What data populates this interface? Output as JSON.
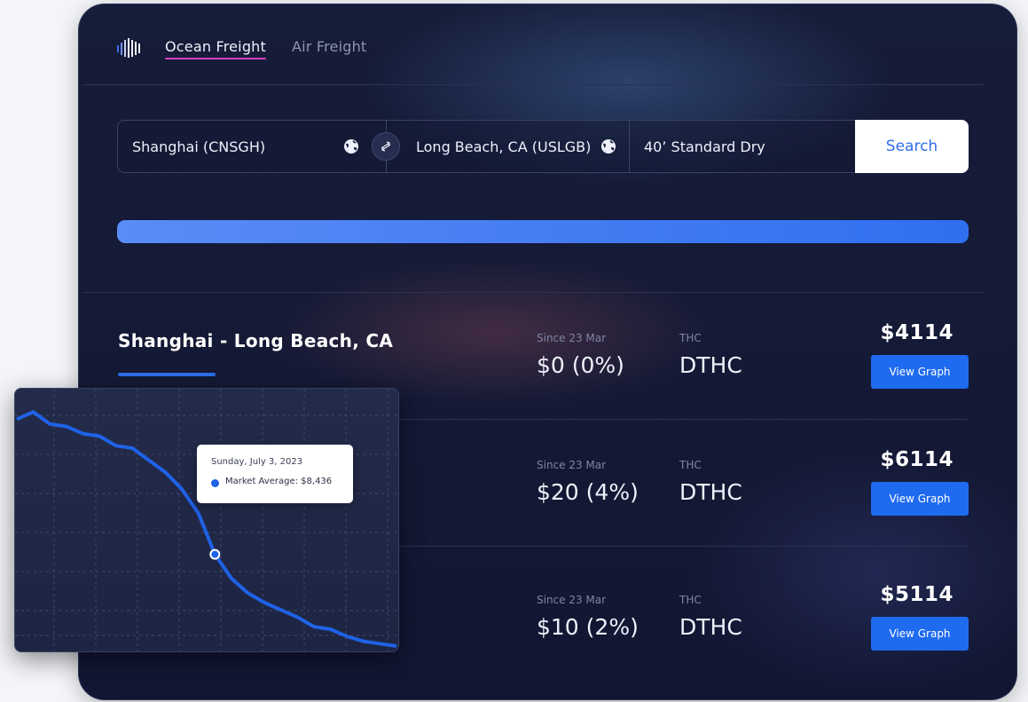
{
  "header": {
    "logo_icon": "barcode-logo-icon",
    "tabs": [
      {
        "label": "Ocean Freight",
        "active": true
      },
      {
        "label": "Air Freight",
        "active": false
      }
    ]
  },
  "search": {
    "origin": "Shanghai (CNSGH)",
    "destination": "Long Beach, CA (USLGB)",
    "container": "40’ Standard Dry",
    "button_label": "Search",
    "swap_icon": "swap-arrows-icon",
    "globe_icon": "globe-icon"
  },
  "progress": {
    "value": 1.0
  },
  "route": {
    "title": "Shanghai - Long Beach, CA"
  },
  "rows": [
    {
      "since_label": "Since 23 Mar",
      "change": "$0 (0%)",
      "thc_label": "THC",
      "thc_value": "DTHC",
      "price": "$4114",
      "button": "View Graph"
    },
    {
      "since_label": "Since 23 Mar",
      "change": "$20 (4%)",
      "thc_label": "THC",
      "thc_value": "DTHC",
      "price": "$6114",
      "button": "View Graph"
    },
    {
      "since_label": "Since 23 Mar",
      "change": "$10 (2%)",
      "thc_label": "THC",
      "thc_value": "DTHC",
      "price": "$5114",
      "button": "View Graph"
    }
  ],
  "tooltip": {
    "date": "Sunday, July 3, 2023",
    "series_label": "Market Average: $8,436"
  },
  "chart_data": {
    "type": "line",
    "series": [
      {
        "values": [
          0.06,
          0.03,
          0.08,
          0.09,
          0.12,
          0.13,
          0.17,
          0.18,
          0.23,
          0.28,
          0.35,
          0.45,
          0.62,
          0.72,
          0.78,
          0.82,
          0.85,
          0.88,
          0.92,
          0.93,
          0.96,
          0.98,
          0.99,
          1.0
        ]
      }
    ],
    "highlight_index": 12,
    "colors": {
      "line": "#1f62e6",
      "grid": "#3f496e"
    }
  }
}
